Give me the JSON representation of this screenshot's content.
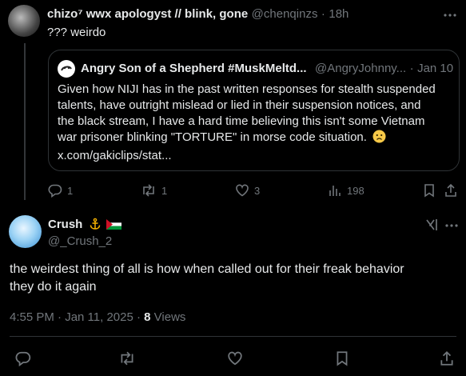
{
  "reply_tweet": {
    "display_name": "chizo⁷ wwx apologyst // blink, gone",
    "handle": "@chenqinzs",
    "separator": "·",
    "time": "18h",
    "text": "??? weirdo"
  },
  "quoted_tweet": {
    "display_name": "Angry Son of a Shepherd #MuskMeltd...",
    "handle": "@AngryJohnny...",
    "separator": "·",
    "date": "Jan 10",
    "text_lines": [
      "Given how NIJI has in the past written responses for stealth suspended",
      "talents, have outright mislead or lied in their suspension notices, and",
      "the black stream, I have a hard time believing this isn't some Vietnam",
      "war prisoner blinking \"TORTURE\" in morse code situation."
    ],
    "link": "x.com/gakiclips/stat..."
  },
  "reply_actions": {
    "replies": "1",
    "reposts": "1",
    "likes": "3",
    "views": "198"
  },
  "main_tweet": {
    "display_name": "Crush",
    "handle": "@_Crush_2",
    "text_line1": "the weirdest thing of all is how when called out for their freak behavior",
    "text_line2": "they do it again",
    "timestamp": "4:55 PM · Jan 11, 2025 · ",
    "views_count": "8",
    "views_label": " Views"
  },
  "colors": {
    "background": "#000000",
    "text": "#e7e9ea",
    "muted": "#71767b",
    "border": "#2f3336"
  }
}
